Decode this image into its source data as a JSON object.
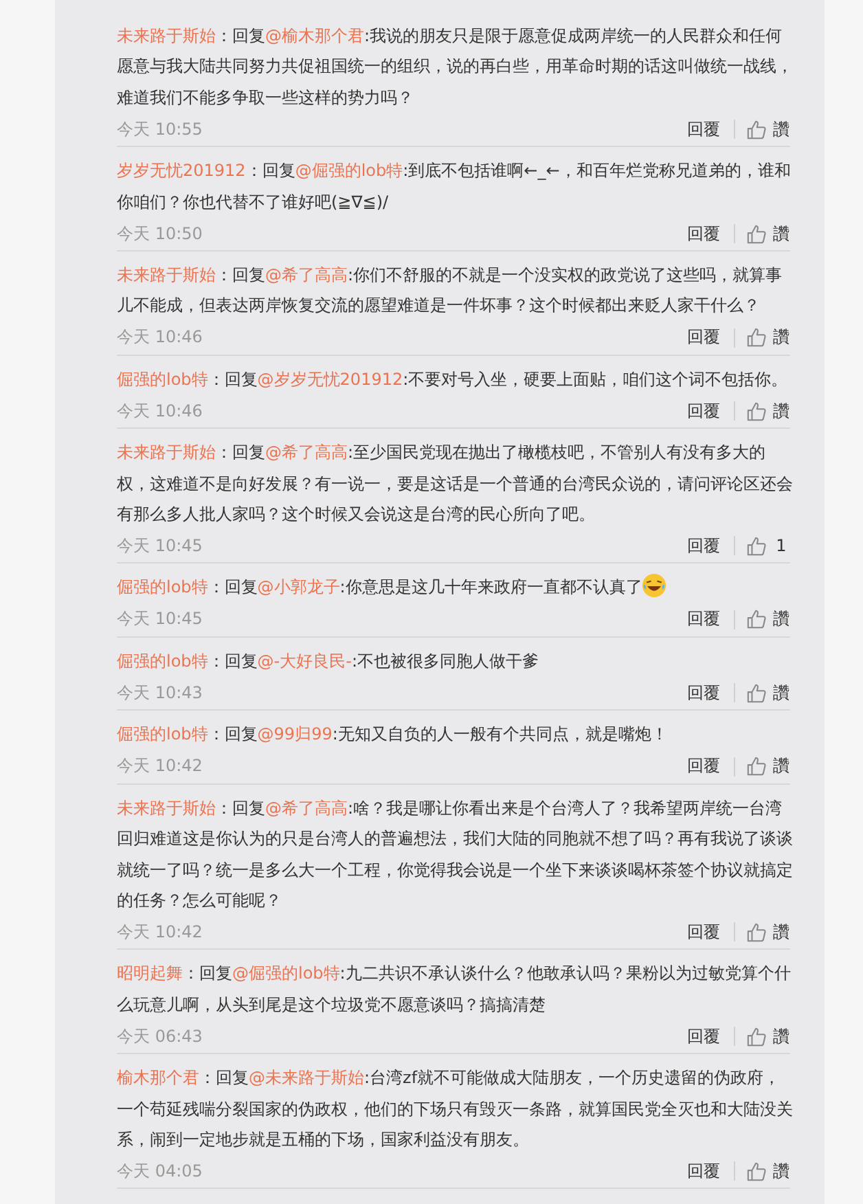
{
  "comments": [
    {
      "author": "未来路于斯始",
      "reply_prefix": "：回复",
      "reply_to": "@榆木那个君",
      "text": ":我说的朋友只是限于愿意促成两岸统一的人民群众和任何愿意与我大陆共同努力共促祖国统一的组织，说的再白些，用革命时期的话这叫做统一战线，难道我们不能多争取一些这样的势力吗？",
      "time": "今天 10:55",
      "reply_label": "回覆",
      "like_label": "讚"
    },
    {
      "author": "岁岁无忧201912",
      "reply_prefix": "：回复",
      "reply_to": "@倔强的lob特",
      "text": ":到底不包括谁啊←_←，和百年烂党称兄道弟的，谁和你咱们？你也代替不了谁好吧(≧∇≦)/",
      "time": "今天 10:50",
      "reply_label": "回覆",
      "like_label": "讚"
    },
    {
      "author": "未来路于斯始",
      "reply_prefix": "：回复",
      "reply_to": "@希了高高",
      "text": ":你们不舒服的不就是一个没实权的政党说了这些吗，就算事儿不能成，但表达两岸恢复交流的愿望难道是一件坏事？这个时候都出来贬人家干什么？",
      "time": "今天 10:46",
      "reply_label": "回覆",
      "like_label": "讚"
    },
    {
      "author": "倔强的lob特",
      "reply_prefix": "：回复",
      "reply_to": "@岁岁无忧201912",
      "text": ":不要对号入坐，硬要上面贴，咱们这个词不包括你。",
      "time": "今天 10:46",
      "reply_label": "回覆",
      "like_label": "讚"
    },
    {
      "author": "未来路于斯始",
      "reply_prefix": "：回复",
      "reply_to": "@希了高高",
      "text": ":至少国民党现在抛出了橄榄枝吧，不管别人有没有多大的权，这难道不是向好发展？有一说一，要是这话是一个普通的台湾民众说的，请问评论区还会有那么多人批人家吗？这个时候又会说这是台湾的民心所向了吧。",
      "time": "今天 10:45",
      "reply_label": "回覆",
      "like_label": "1"
    },
    {
      "author": "倔强的lob特",
      "reply_prefix": "：回复",
      "reply_to": "@小郭龙子",
      "text": ":你意思是这几十年来政府一直都不认真了",
      "kind": "emoji",
      "time": "今天 10:45",
      "reply_label": "回覆",
      "like_label": "讚"
    },
    {
      "author": "倔强的lob特",
      "reply_prefix": "：回复",
      "reply_to": "@-大好良民-",
      "text": ":不也被很多同胞人做干爹",
      "time": "今天 10:43",
      "reply_label": "回覆",
      "like_label": "讚"
    },
    {
      "author": "倔强的lob特",
      "reply_prefix": "：回复",
      "reply_to": "@99归99",
      "text": ":无知又自负的人一般有个共同点，就是嘴炮！",
      "time": "今天 10:42",
      "reply_label": "回覆",
      "like_label": "讚"
    },
    {
      "author": "未来路于斯始",
      "reply_prefix": "：回复",
      "reply_to": "@希了高高",
      "text": ":啥？我是哪让你看出来是个台湾人了？我希望两岸统一台湾回归难道这是你认为的只是台湾人的普遍想法，我们大陆的同胞就不想了吗？再有我说了谈谈就统一了吗？统一是多么大一个工程，你觉得我会说是一个坐下来谈谈喝杯茶签个协议就搞定的任务？怎么可能呢？",
      "time": "今天 10:42",
      "reply_label": "回覆",
      "like_label": "讚"
    },
    {
      "author": "昭明起舞",
      "reply_prefix": "：回复",
      "reply_to": "@倔强的lob特",
      "text": ":九二共识不承认谈什么？他敢承认吗？果粉以为过敏党算个什么玩意儿啊，从头到尾是这个垃圾党不愿意谈吗？搞搞清楚",
      "time": "今天 06:43",
      "reply_label": "回覆",
      "like_label": "讚"
    },
    {
      "author": "榆木那个君",
      "reply_prefix": "：回复",
      "reply_to": "@未来路于斯始",
      "text": ":台湾zf就不可能做成大陆朋友，一个历史遗留的伪政府，一个苟延残喘分裂国家的伪政权，他们的下场只有毁灭一条路，就算国民党全灭也和大陆没关系，闹到一定地步就是五桶的下场，国家利益没有朋友。",
      "time": "今天 04:05",
      "reply_label": "回覆",
      "like_label": "讚"
    }
  ]
}
